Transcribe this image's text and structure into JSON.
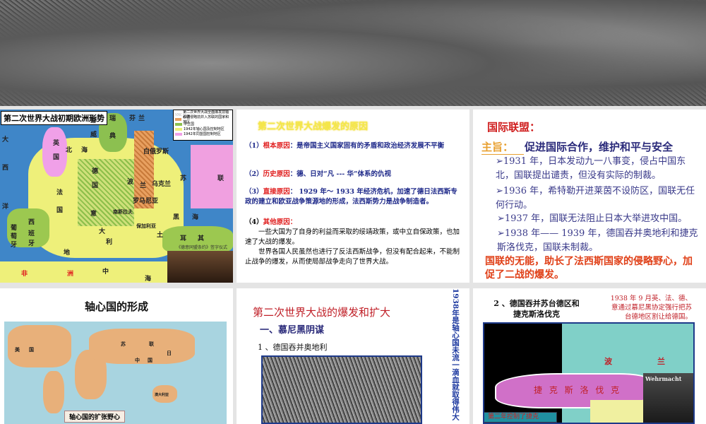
{
  "slide1": {
    "title": "第二次世界大战初期欧洲形势",
    "legend": [
      "第二次世界大战全面爆发前轴心国",
      "那德侵略前并入苏联的国家和地区",
      "中立国",
      "1942年轴心国及控制地区",
      "1942年同盟国控制地区"
    ],
    "labels": [
      "大",
      "西",
      "洋",
      "北",
      "海",
      "英",
      "国",
      "法",
      "国",
      "德",
      "国",
      "意",
      "大",
      "利",
      "波",
      "兰",
      "苏",
      "联",
      "芬",
      "兰",
      "瑞",
      "典",
      "挪",
      "威",
      "西",
      "班",
      "牙",
      "葡",
      "萄",
      "牙",
      "地",
      "中",
      "海",
      "黑",
      "海",
      "罗马尼亚",
      "白俄罗斯",
      "乌克兰",
      "南斯拉夫",
      "保加利亚",
      "土",
      "耳",
      "其",
      "非",
      "洲"
    ],
    "caption": "《德意同盟条约》签字仪式"
  },
  "slide2": {
    "title": "第二次世界大战爆发的原因",
    "items": [
      {
        "num": "（1）",
        "label": "根本原因",
        "text": "：是帝国主义国家固有的矛盾和政治经济发展不平衡"
      },
      {
        "num": "（2）",
        "label": "历史原因",
        "text": "：德、日对“凡 --- 华”体系的仇视"
      },
      {
        "num": "（3）",
        "label": "直接原因",
        "text": "： 1929 年～ 1933 年经济危机，加速了德日法西斯专政的建立和欧亚战争策源地的形成，法西斯势力是战争制造者。"
      },
      {
        "num": "（4）",
        "label": "其他原因：",
        "text": ""
      }
    ],
    "para1": "一些大国为了自身的利益而采取的绥靖政策，或中立自保政策，也加速了大战的爆发。",
    "para2": "世界各国人民虽然也进行了反法西斯战争，但没有配合起来，不能制止战争的爆发，从而使局部战争走向了世界大战。"
  },
  "slide3": {
    "title": "国际联盟：",
    "aim_label": "主旨：",
    "aim": "促进国际合作，维护和平与安全",
    "items": [
      "➢1931 年，日本发动九一八事变，侵占中国东北，国联提出谴责，但没有实际的制裁。",
      "➢1936 年，希特勒开进莱茵不设防区，国联无任何行动。",
      "➢1937 年，国联无法阻止日本大举进攻中国。",
      "➢1938 年—— 1939 年，德国吞并奥地利和捷克斯洛伐克，国联未制裁。"
    ],
    "conclusion": "国联的无能，助长了法西斯国家的侵略野心，加促了二战的爆发。"
  },
  "slide4": {
    "title": "轴心国的形成",
    "map_caption": "轴心国的扩张野心",
    "labels": [
      "美",
      "国",
      "苏",
      "联",
      "中",
      "国",
      "日",
      "澳大利亚"
    ]
  },
  "slide5": {
    "title": "第二次世界大战的爆发和扩大",
    "subtitle": "一、慕尼黑阴谋",
    "item": "1 、德国吞并奥地利",
    "vertical": "1938年是轴心国未流一滴血就取得伟大"
  },
  "slide6": {
    "title": "2 、德国吞并苏台德区和捷克斯洛伐克",
    "note": "1938 年 9 月英、法、德、意通过慕尼黑协定强行把苏台德地区割让给德国。",
    "map_czech": "捷 克 斯 洛 伐 克",
    "map_poland_1": "波",
    "map_poland_2": "兰",
    "callout": "第二年控制了捷克",
    "poster": "Wehrmacht"
  }
}
